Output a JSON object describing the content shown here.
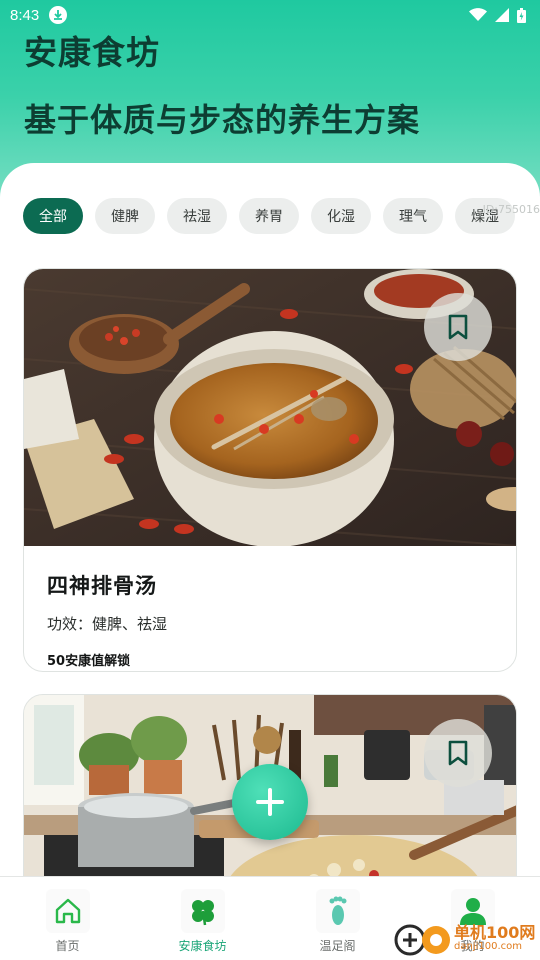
{
  "status_bar": {
    "time": "8:43"
  },
  "header": {
    "title": "安康食坊",
    "subtitle": "基于体质与步态的养生方案"
  },
  "filters": {
    "chips": [
      "全部",
      "健脾",
      "祛湿",
      "养胃",
      "化湿",
      "理气",
      "燥湿"
    ],
    "active_index": 0,
    "watermark_id": "ID:755016"
  },
  "recipes": [
    {
      "title": "四神排骨汤",
      "effect": "功效：健脾、祛湿",
      "unlock": "50安康值解锁",
      "bookmark_icon": "bookmark-icon"
    },
    {
      "bookmark_icon": "bookmark-icon"
    }
  ],
  "bottom_nav": {
    "items": [
      {
        "label": "首页",
        "icon": "home-icon"
      },
      {
        "label": "安康食坊",
        "icon": "clover-icon"
      },
      {
        "label": "温足阁",
        "icon": "footprint-icon"
      },
      {
        "label": "我的",
        "icon": "person-icon"
      }
    ],
    "active_index": 1
  },
  "watermark": {
    "name": "单机100网",
    "url": "danji100.com"
  },
  "colors": {
    "accent": "#0c6b52",
    "header_gradient_top": "#1fc9a0",
    "fab": "#2cc99b",
    "nav_active": "#1ca678"
  }
}
